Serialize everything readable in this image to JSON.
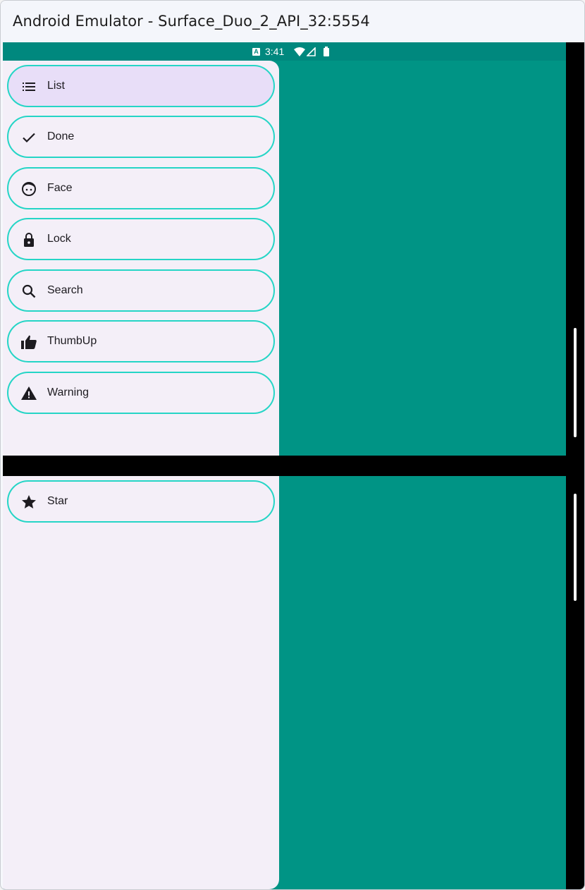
{
  "window": {
    "title": "Android Emulator - Surface_Duo_2_API_32:5554"
  },
  "status_bar": {
    "badge": "A",
    "time": "3:41",
    "icons": [
      "wifi-icon",
      "signal-icon",
      "battery-icon"
    ],
    "color": "#00887e"
  },
  "colors": {
    "pane": "#009485",
    "drawer": "#f4eff8",
    "selected": "#e8def8",
    "item_border": "#25d5c6",
    "hinge": "#000000"
  },
  "nav_top": [
    {
      "label": "List",
      "icon": "list-icon",
      "selected": true
    },
    {
      "label": "Done",
      "icon": "check-icon",
      "selected": false
    },
    {
      "label": "Face",
      "icon": "face-icon",
      "selected": false
    },
    {
      "label": "Lock",
      "icon": "lock-icon",
      "selected": false
    },
    {
      "label": "Search",
      "icon": "search-icon",
      "selected": false
    },
    {
      "label": "ThumbUp",
      "icon": "thumb-up-icon",
      "selected": false
    },
    {
      "label": "Warning",
      "icon": "warning-icon",
      "selected": false
    }
  ],
  "nav_bottom": [
    {
      "label": "Star",
      "icon": "star-icon",
      "selected": false
    }
  ]
}
